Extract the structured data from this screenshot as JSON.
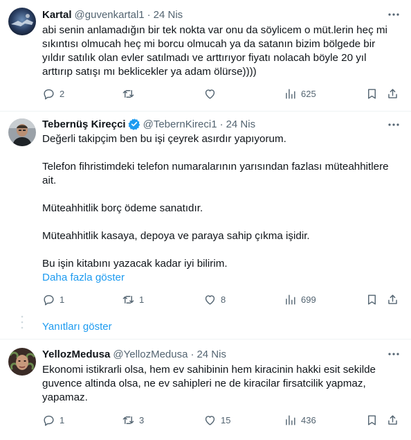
{
  "tweets": [
    {
      "name": "Kartal",
      "handle": "@guvenkartal1",
      "separator": "·",
      "date": "24 Nis",
      "lines": [
        "abi senin anlamadığın bir tek nokta var onu da söylicem o müt.lerin heç mi",
        "sıkıntısı olmucah heç mi borcu olmucah ya da satanın bizim bölgede bir",
        "yıldır satılık olan evler satılmadı ve arttırıyor fiyatı nolacah böyle 20 yıl",
        "arttırıp satışı mı beklicekler ya adam ölürse))))"
      ],
      "replies": "2",
      "retweets": "",
      "likes": "",
      "views": "625"
    },
    {
      "name": "Tebernüş Kireçci",
      "handle": "@TebernKireci1",
      "separator": "·",
      "date": "24 Nis",
      "verified": true,
      "paragraphs": [
        "Değerli takipçim ben bu işi çeyrek asırdır yapıyorum.",
        "Telefon fihristimdeki telefon numaralarının yarısından fazlası müteahhitlere ait.",
        "Müteahhitlik borç ödeme sanatıdır.",
        "Müteahhitlik kasaya, depoya ve paraya sahip çıkma işidir.",
        "Bu işin kitabını yazacak kadar iyi bilirim."
      ],
      "show_more": "Daha fazla göster",
      "replies": "1",
      "retweets": "1",
      "likes": "8",
      "views": "699"
    },
    {
      "name": "YellozMedusa",
      "handle": "@YellozMedusa",
      "separator": "·",
      "date": "24 Nis",
      "lines": [
        "Ekonomi istikrarli olsa, hem ev sahibinin hem kiracinin hakki esit sekilde",
        "guvence altinda olsa, ne ev sahipleri ne de kiracilar firsatcilik yapmaz,",
        "yapamaz."
      ],
      "replies": "1",
      "retweets": "3",
      "likes": "15",
      "views": "436"
    }
  ],
  "show_replies": "Yanıtları göster",
  "icons": {
    "reply": "reply-icon",
    "retweet": "retweet-icon",
    "like": "heart-icon",
    "views": "views-icon",
    "bookmark": "bookmark-icon",
    "share": "share-icon",
    "more": "more-icon",
    "verified": "verified-badge-icon"
  },
  "colors": {
    "text": "#0f1419",
    "muted": "#536471",
    "link": "#1d9bf0",
    "divider": "#eff3f4"
  }
}
